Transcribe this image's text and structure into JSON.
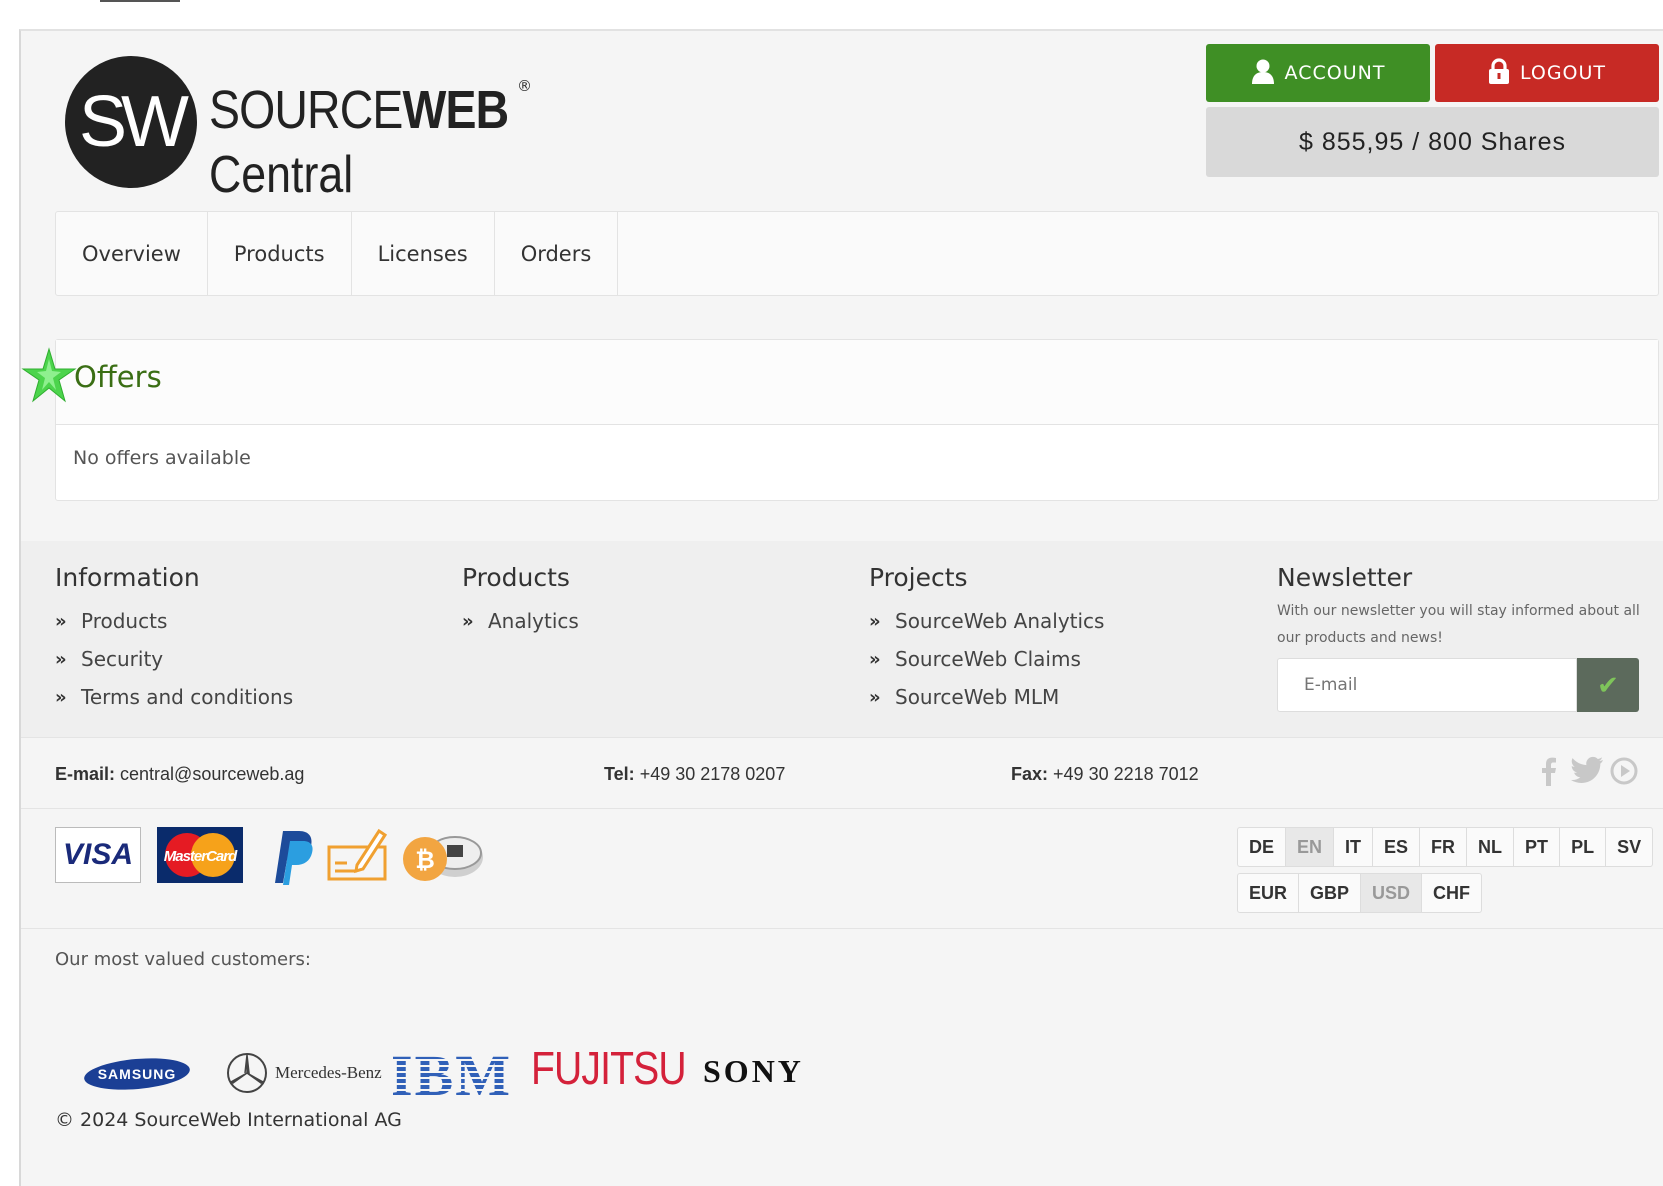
{
  "header": {
    "logo_word1_light": "SOURCE",
    "logo_word1_bold": "WEB",
    "logo_registered": "®",
    "logo_word2": "Central",
    "logo_mark": "SW",
    "account_label": "ACCOUNT",
    "logout_label": "LOGOUT",
    "balance": "$ 855,95 / 800 Shares",
    "account_color": "#3f8f25",
    "logout_color": "#c72a25"
  },
  "nav": {
    "items": [
      {
        "label": "Overview"
      },
      {
        "label": "Products"
      },
      {
        "label": "Licenses"
      },
      {
        "label": "Orders"
      }
    ]
  },
  "offers": {
    "title": "Offers",
    "empty_text": "No offers available",
    "icon": "star-icon",
    "icon_color": "#4cd44c"
  },
  "footer": {
    "information": {
      "title": "Information",
      "links": [
        "Products",
        "Security",
        "Terms and conditions"
      ]
    },
    "products": {
      "title": "Products",
      "links": [
        "Analytics"
      ]
    },
    "projects": {
      "title": "Projects",
      "links": [
        "SourceWeb Analytics",
        "SourceWeb Claims",
        "SourceWeb MLM"
      ]
    },
    "newsletter": {
      "title": "Newsletter",
      "description": "With our newsletter you will stay informed about all our products and news!",
      "placeholder": "E-mail"
    },
    "contact": {
      "email_label": "E-mail:",
      "email_value": "central@sourceweb.ag",
      "tel_label": "Tel:",
      "tel_value": "+49 30 2178 0207",
      "fax_label": "Fax:",
      "fax_value": "+49 30 2218 7012"
    },
    "payment": {
      "visa_label": "VISA",
      "mastercard_label": "MasterCard",
      "icons": [
        "visa-icon",
        "mastercard-icon",
        "paypal-icon",
        "check-payment-icon",
        "bitcoin-icon"
      ]
    },
    "languages": [
      "DE",
      "EN",
      "IT",
      "ES",
      "FR",
      "NL",
      "PT",
      "PL",
      "SV"
    ],
    "active_language": "EN",
    "currencies": [
      "EUR",
      "GBP",
      "USD",
      "CHF"
    ],
    "active_currency": "USD",
    "customers_label": "Our most valued customers:",
    "customers": [
      "SAMSUNG",
      "Mercedes-Benz",
      "IBM",
      "FUJITSU",
      "SONY"
    ],
    "copyright": "© 2024 SourceWeb International AG"
  }
}
